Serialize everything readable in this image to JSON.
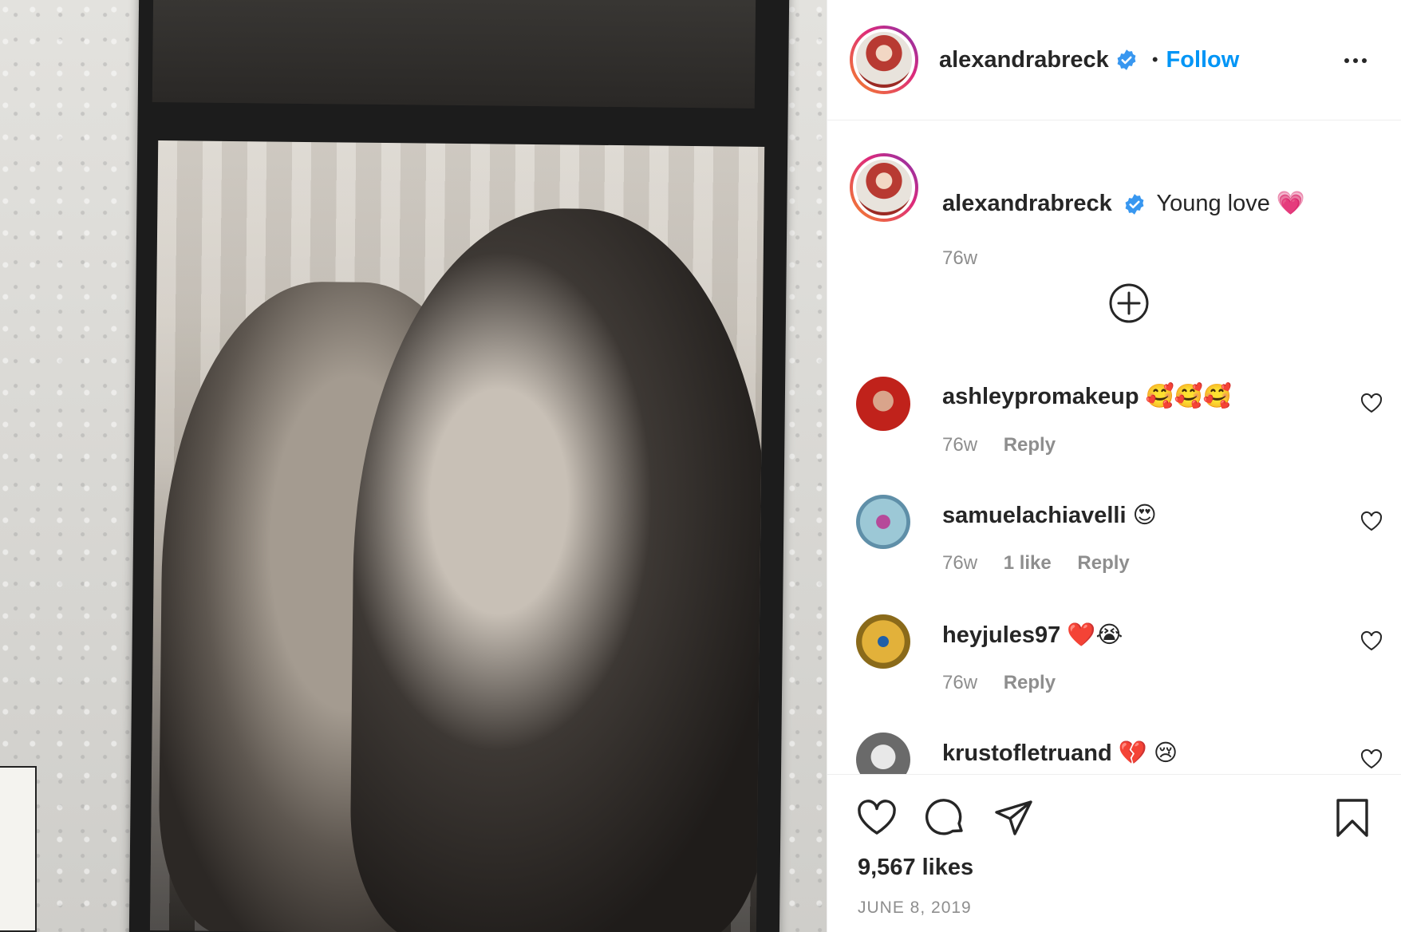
{
  "post": {
    "username": "alexandrabreck",
    "follow_label": "Follow",
    "dot": "•",
    "caption_text": "Young love 💗",
    "caption_time": "76w"
  },
  "comments": [
    {
      "username": "ashleypromakeup",
      "text": "🥰🥰🥰",
      "time": "76w",
      "likes": "",
      "reply": "Reply",
      "avatar_color": "#c0221b"
    },
    {
      "username": "samuelachiavelli",
      "text": "😍",
      "time": "76w",
      "likes": "1 like",
      "reply": "Reply",
      "avatar_color": "#6fb0c9"
    },
    {
      "username": "heyjules97",
      "text": "❤️😭",
      "time": "76w",
      "likes": "",
      "reply": "Reply",
      "avatar_color": "#c99a1e"
    },
    {
      "username": "krustofletruand",
      "text": "💔 😢",
      "time": "",
      "likes": "",
      "reply": "",
      "avatar_color": "#6a6a6a"
    }
  ],
  "actions": {
    "likes_label": "9,567 likes",
    "date_label": "JUNE 8, 2019"
  },
  "icons": {
    "verified": "verified-badge-icon",
    "more": "more-options-icon",
    "load_more": "plus-circle-icon",
    "like": "heart-icon",
    "comment": "comment-bubble-icon",
    "share": "paper-plane-icon",
    "save": "bookmark-icon"
  },
  "colors": {
    "accent": "#0095f6",
    "text": "#262626",
    "muted": "#8e8e8e",
    "border": "#efefef"
  }
}
